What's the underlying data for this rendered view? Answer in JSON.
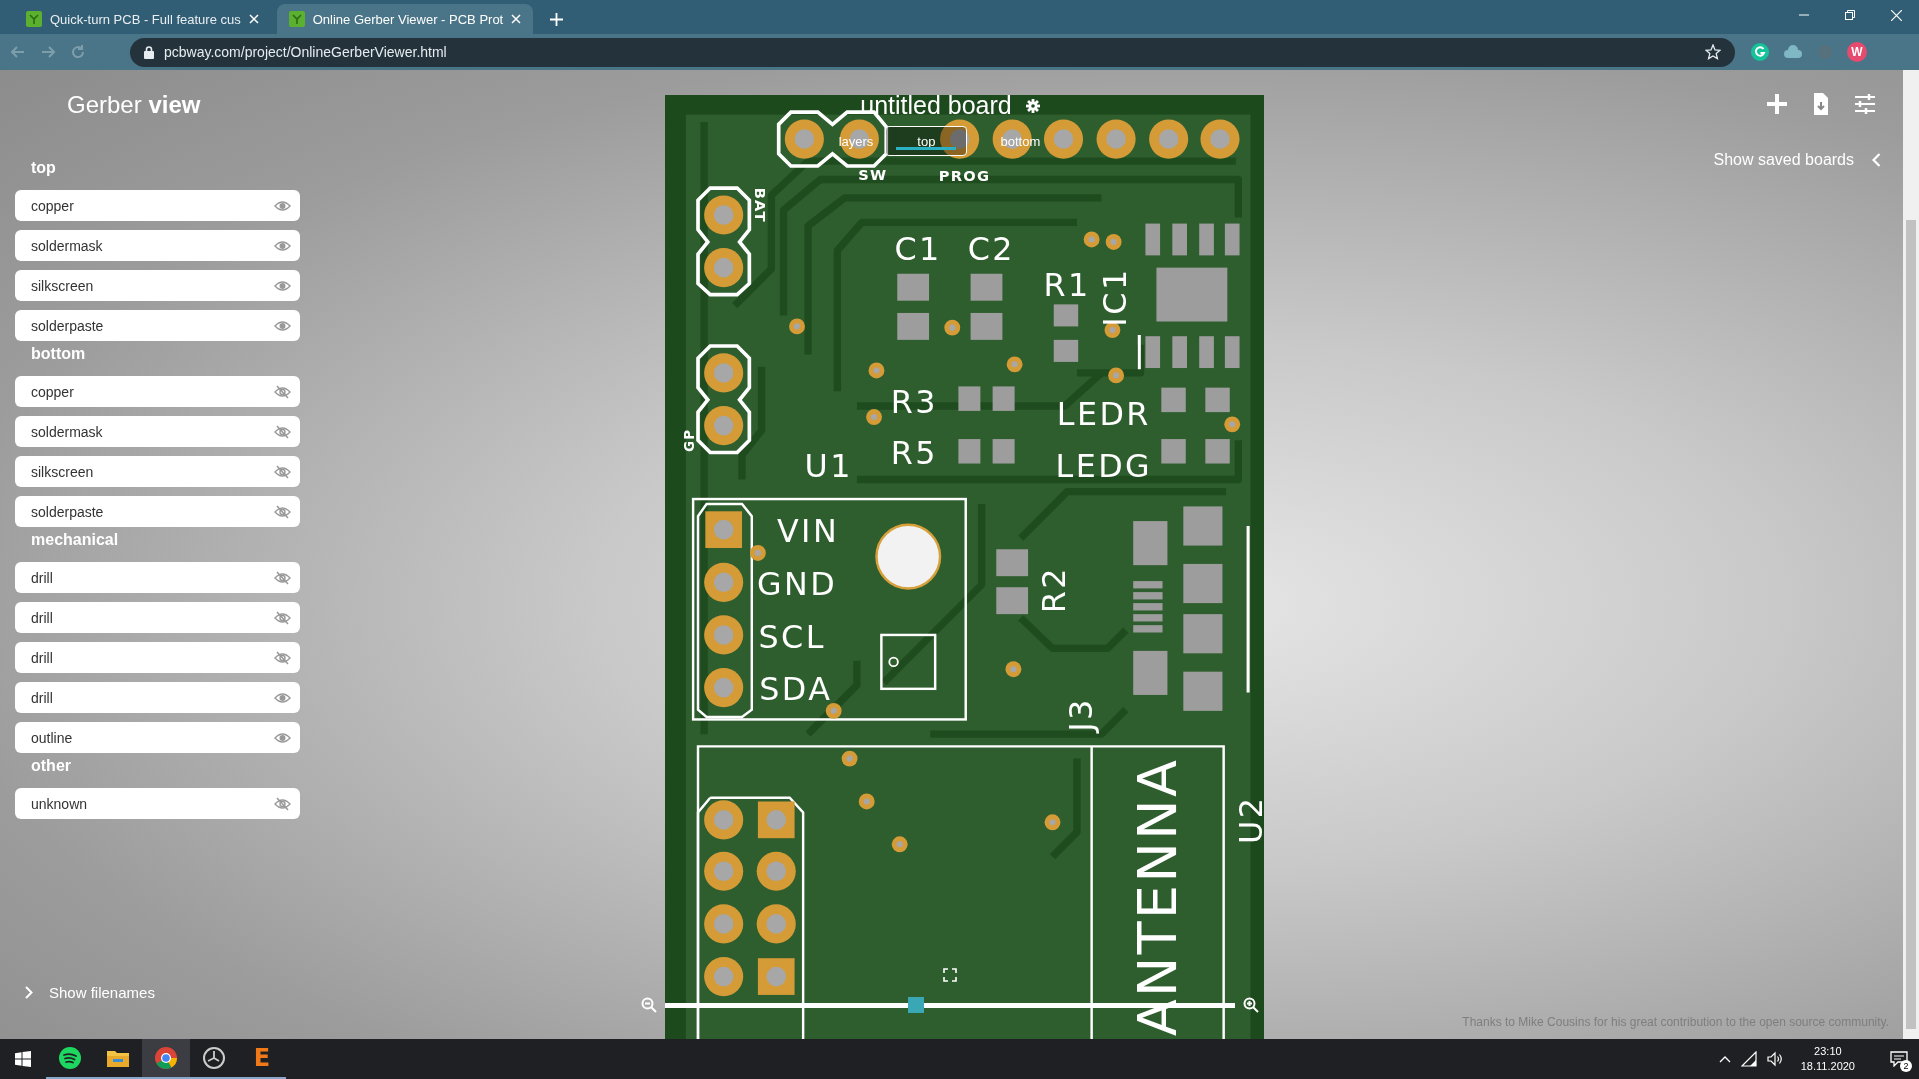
{
  "browser": {
    "tabs": [
      {
        "title": "Quick-turn PCB - Full feature cus",
        "selected": false
      },
      {
        "title": "Online Gerber Viewer - PCB Prot",
        "selected": true
      }
    ],
    "address": "pcbway.com/project/OnlineGerberViewer.html",
    "profile_initial": "W"
  },
  "sidebar": {
    "title": "Gerber **view**",
    "groups": [
      {
        "name": "top",
        "layers": [
          {
            "name": "copper",
            "visible": true
          },
          {
            "name": "soldermask",
            "visible": true
          },
          {
            "name": "silkscreen",
            "visible": true
          },
          {
            "name": "solderpaste",
            "visible": true
          }
        ]
      },
      {
        "name": "bottom",
        "layers": [
          {
            "name": "copper",
            "visible": false
          },
          {
            "name": "soldermask",
            "visible": false
          },
          {
            "name": "silkscreen",
            "visible": false
          },
          {
            "name": "solderpaste",
            "visible": false
          }
        ]
      },
      {
        "name": "mechanical",
        "layers": [
          {
            "name": "drill",
            "visible": false
          },
          {
            "name": "drill",
            "visible": false
          },
          {
            "name": "drill",
            "visible": false
          },
          {
            "name": "drill",
            "visible": true
          },
          {
            "name": "outline",
            "visible": true
          }
        ]
      },
      {
        "name": "other",
        "layers": [
          {
            "name": "unknown",
            "visible": false
          }
        ]
      }
    ],
    "footer_toggle": "Show filenames"
  },
  "board": {
    "title": "untitled board",
    "view_label": "layers",
    "view_tabs": [
      {
        "label": "top",
        "selected": true
      },
      {
        "label": "bottom",
        "selected": false
      }
    ],
    "silkscreen": [
      "SW",
      "PROG",
      "BAT",
      "GP",
      "C1",
      "C2",
      "R1",
      "IC1",
      "R3",
      "LEDR",
      "R5",
      "U1",
      "LEDG",
      "VIN",
      "GND",
      "SCL",
      "SDA",
      "R2",
      "J3",
      "ANTENNA",
      "U2"
    ],
    "zoom": {
      "level": 0.44
    }
  },
  "right_panel": {
    "saved_boards": "Show saved boards",
    "credit": "Thanks to Mike Cousins for his great contribution to the open source community."
  },
  "taskbar": {
    "apps": [
      {
        "kind": "spotify",
        "selected": false
      },
      {
        "kind": "folder",
        "selected": false
      },
      {
        "kind": "chrome",
        "selected": true
      },
      {
        "kind": "clock",
        "selected": false
      },
      {
        "kind": "letter",
        "glyph": "E",
        "selected": false
      }
    ],
    "time": "23:10",
    "date": "18.11.2020",
    "notifications": "2"
  }
}
